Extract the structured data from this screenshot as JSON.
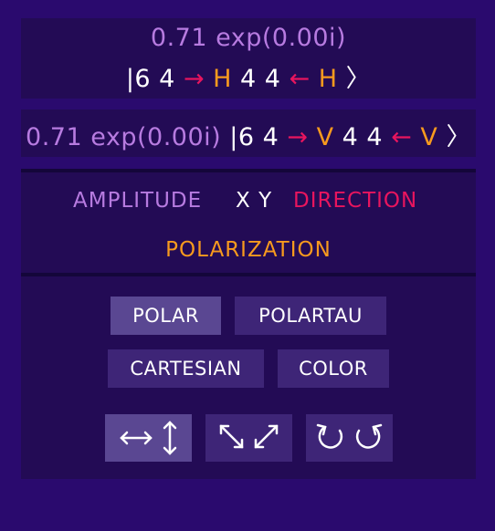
{
  "state1": {
    "amplitude": "0.71 exp(0.00i)",
    "ket_open": "|6 4 ",
    "arrow1": "→",
    "pol1": " H ",
    "coords2": "4 4 ",
    "arrow2": "←",
    "pol2": " H ",
    "ket_close": "〉"
  },
  "state2": {
    "amplitude": "0.71 exp(0.00i) ",
    "ket_open": "|6 4 ",
    "arrow1": "→",
    "pol1": " V ",
    "coords2": "4 4 ",
    "arrow2": "←",
    "pol2": " V ",
    "ket_close": "〉"
  },
  "legend": {
    "amplitude": "AMPLITUDE",
    "xy": "X Y",
    "direction": "DIRECTION",
    "polarization": "POLARIZATION"
  },
  "controls": {
    "polar": "POLAR",
    "polartau": "POLARTAU",
    "cartesian": "CARTESIAN",
    "color": "COLOR"
  },
  "colors": {
    "amplitude": "#b77be0",
    "direction": "#e8155e",
    "polarization": "#f79a1e"
  },
  "icons": [
    "horizontal-vertical-basis-icon",
    "diagonal-basis-icon",
    "circular-basis-icon"
  ]
}
